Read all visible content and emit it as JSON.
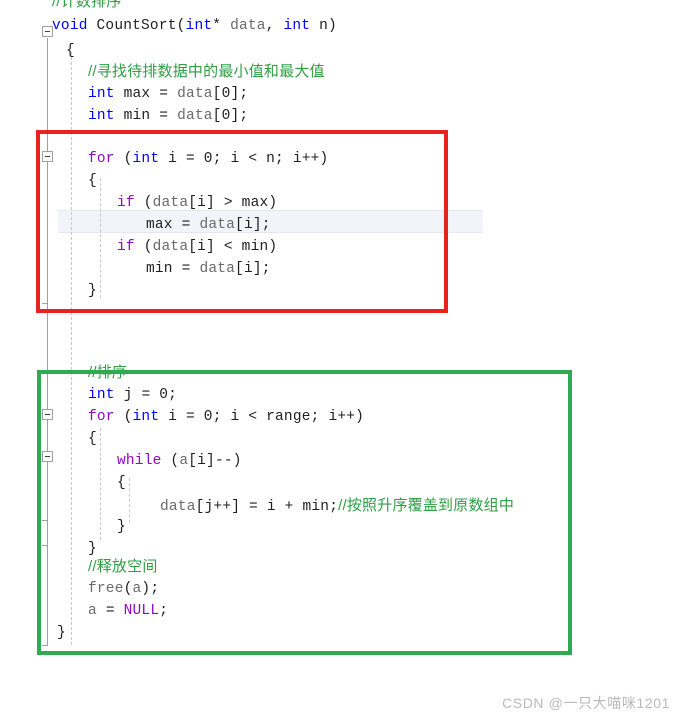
{
  "watermark": "CSDN @一只大喵咪1201",
  "colors": {
    "keyword": "#0000ff",
    "control": "#8f08c4",
    "macro": "#8f08c4",
    "identifier": "#6a6a6a",
    "comment": "#2f9e44",
    "plain_text": "#1f1f1f",
    "background": "#ffffff",
    "current_line_highlight": "#f3f3fa",
    "fold_gutter": "#a0a0a0",
    "indent_guide": "#c8c8c8",
    "annotation_red": "#e8221f",
    "annotation_green": "#2eab51"
  },
  "code_lines": [
    {
      "id": "l0",
      "text": "//计数排序"
    },
    {
      "id": "l1",
      "text": "void CountSort(int* data, int n)"
    },
    {
      "id": "l2",
      "text": "{"
    },
    {
      "id": "l3",
      "text": "    //寻找待排数据中的最小值和最大值"
    },
    {
      "id": "l4",
      "text": "    int max = data[0];"
    },
    {
      "id": "l5",
      "text": "    int min = data[0];"
    },
    {
      "id": "l6",
      "text": ""
    },
    {
      "id": "l7",
      "text": "    for (int i = 0; i < n; i++)"
    },
    {
      "id": "l8",
      "text": "    {"
    },
    {
      "id": "l9",
      "text": "        if (data[i] > max)"
    },
    {
      "id": "l10",
      "text": "            max = data[i];"
    },
    {
      "id": "l11",
      "text": "        if (data[i] < min)"
    },
    {
      "id": "l12",
      "text": "            min = data[i];"
    },
    {
      "id": "l13",
      "text": "    }"
    },
    {
      "id": "l14",
      "text": ""
    },
    {
      "id": "l15",
      "text": ""
    },
    {
      "id": "l16",
      "text": "    //排序"
    },
    {
      "id": "l17",
      "text": "    int j = 0;"
    },
    {
      "id": "l18",
      "text": "    for (int i = 0; i < range; i++)"
    },
    {
      "id": "l19",
      "text": "    {"
    },
    {
      "id": "l20",
      "text": "        while (a[i]--)"
    },
    {
      "id": "l21",
      "text": "        {"
    },
    {
      "id": "l22",
      "text": "            data[j++] = i + min;//按照升序覆盖到原数组中"
    },
    {
      "id": "l23",
      "text": "        }"
    },
    {
      "id": "l24",
      "text": "    }"
    },
    {
      "id": "l25",
      "text": "    //释放空间"
    },
    {
      "id": "l26",
      "text": "    free(a);"
    },
    {
      "id": "l27",
      "text": "    a = NULL;"
    },
    {
      "id": "l28",
      "text": "}"
    }
  ],
  "annotations": [
    {
      "id": "red-box",
      "color": "#e8221f",
      "label": "find-min-max-loop-highlight"
    },
    {
      "id": "green-box",
      "color": "#2eab51",
      "label": "sorting-section-highlight"
    }
  ],
  "current_line": {
    "line_id": "l10",
    "text": "            max = data[i];"
  }
}
